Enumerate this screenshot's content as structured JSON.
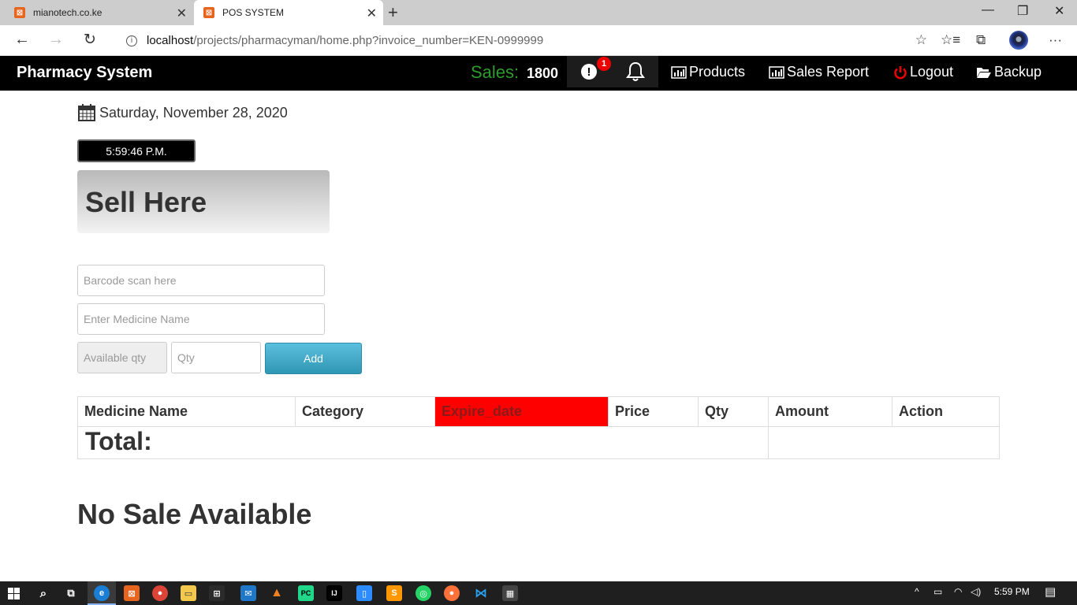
{
  "browser": {
    "tabs": [
      {
        "title": "mianotech.co.ke",
        "active": false
      },
      {
        "title": "POS SYSTEM",
        "active": true
      }
    ],
    "url_host": "localhost",
    "url_path": "/projects/pharmacyman/home.php?invoice_number=KEN-0999999"
  },
  "nav": {
    "brand": "Pharmacy System",
    "sales_label": "Sales:",
    "sales_value": "1800",
    "alert_badge": "1",
    "links": {
      "products": "Products",
      "sales_report": "Sales Report",
      "logout": "Logout",
      "backup": "Backup"
    }
  },
  "main": {
    "date": "Saturday, November 28, 2020",
    "clock": "5:59:46 P.M.",
    "heading": "Sell Here",
    "form": {
      "barcode_placeholder": "Barcode scan here",
      "medicine_placeholder": "Enter Medicine Name",
      "available_placeholder": "Available qty",
      "qty_placeholder": "Qty",
      "add_label": "Add"
    },
    "table": {
      "headers": [
        "Medicine Name",
        "Category",
        "Expire_date",
        "Price",
        "Qty",
        "Amount",
        "Action"
      ],
      "total_label": "Total:"
    },
    "empty_message": "No Sale Available"
  },
  "taskbar": {
    "time": "5:59 PM"
  },
  "colors": {
    "nav_bg": "#000000",
    "sales_label": "#2e9b2e",
    "expire_header": "#ff0000",
    "add_button": "#5bc0de",
    "badge": "#ee0000"
  }
}
